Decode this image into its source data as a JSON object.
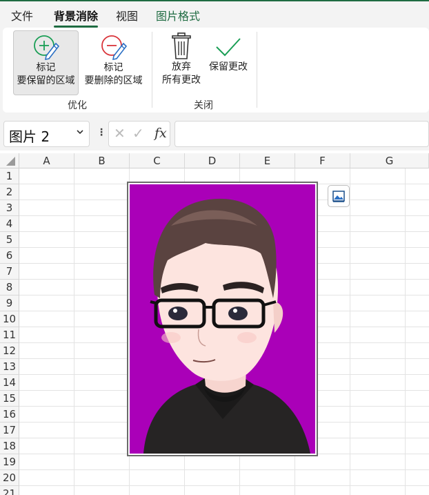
{
  "tabs": [
    {
      "label": "文件"
    },
    {
      "label": "背景消除"
    },
    {
      "label": "视图"
    },
    {
      "label": "图片格式"
    }
  ],
  "ribbon": {
    "mark_keep": {
      "line1": "标记",
      "line2": "要保留的区域"
    },
    "mark_remove": {
      "line1": "标记",
      "line2": "要删除的区域"
    },
    "discard": {
      "line1": "放弃",
      "line2": "所有更改"
    },
    "keep_changes": {
      "label": "保留更改"
    },
    "groups": {
      "refine": "优化",
      "close": "关闭"
    }
  },
  "formula_bar": {
    "name_box": "图片 2",
    "fx_label": "fx",
    "formula": ""
  },
  "columns": [
    "A",
    "B",
    "C",
    "D",
    "E",
    "F",
    "G"
  ],
  "rows": [
    "1",
    "2",
    "3",
    "4",
    "5",
    "6",
    "7",
    "8",
    "9",
    "10",
    "11",
    "12",
    "13",
    "14",
    "15",
    "16",
    "17",
    "18",
    "19",
    "20",
    "21"
  ],
  "picture": {
    "background_color": "#aa00b8"
  },
  "colors": {
    "accent": "#1e6b41",
    "add_green": "#1a9e55",
    "remove_red": "#d9343a"
  }
}
